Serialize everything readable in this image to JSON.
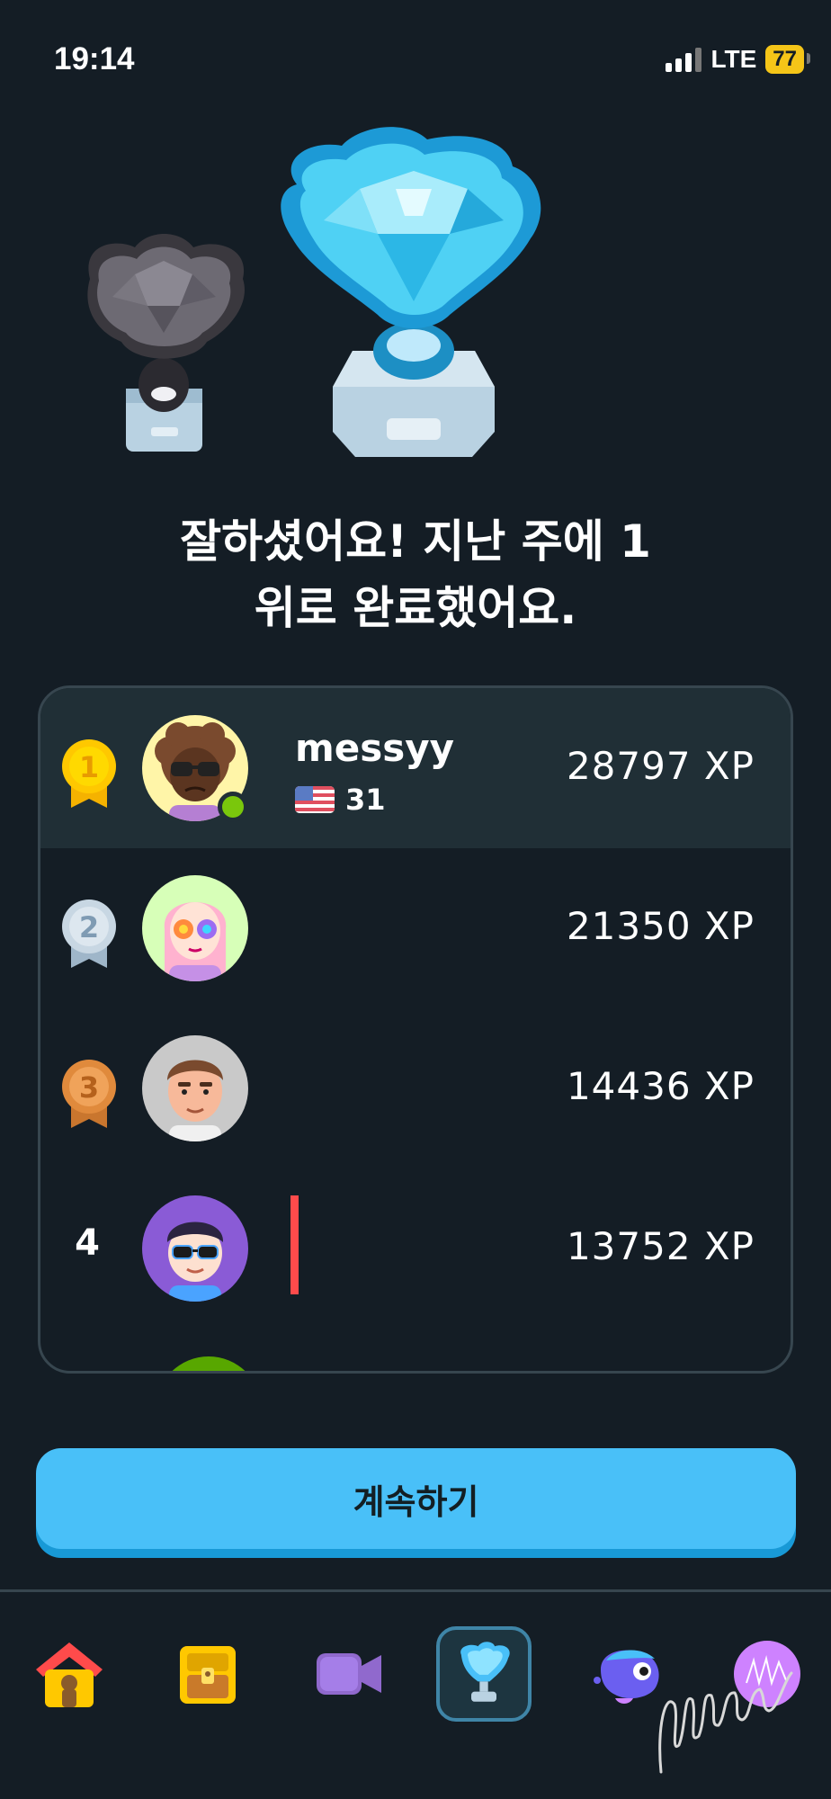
{
  "status_bar": {
    "time": "19:14",
    "network": "LTE",
    "battery": "77"
  },
  "headline": {
    "line1": "잘하셨어요! 지난 주에 1",
    "line2": "위로 완료했어요."
  },
  "leaderboard": {
    "rows": [
      {
        "rank": "1",
        "name": "messyy",
        "streak": "31",
        "xp": "28797 XP",
        "medal": "gold-medal-icon",
        "highlight": true
      },
      {
        "rank": "2",
        "name": "",
        "xp": "21350 XP",
        "medal": "silver-medal-icon"
      },
      {
        "rank": "3",
        "name": "",
        "xp": "14436 XP",
        "medal": "bronze-medal-icon"
      },
      {
        "rank": "4",
        "name": "",
        "xp": "13752 XP"
      }
    ]
  },
  "continue_button": {
    "label": "계속하기"
  },
  "bottom_nav": {
    "items": [
      "home-icon",
      "treasure-chest-icon",
      "video-icon",
      "leaderboard-trophy-icon",
      "duo-character-icon",
      "profile-avatar-icon"
    ],
    "active": "leaderboard-trophy-icon"
  },
  "colors": {
    "background": "#141d25",
    "highlight_row": "#202f36",
    "button": "#49c0f8",
    "accent_gold": "#f5c518",
    "red_marker": "#ff4b4b"
  }
}
